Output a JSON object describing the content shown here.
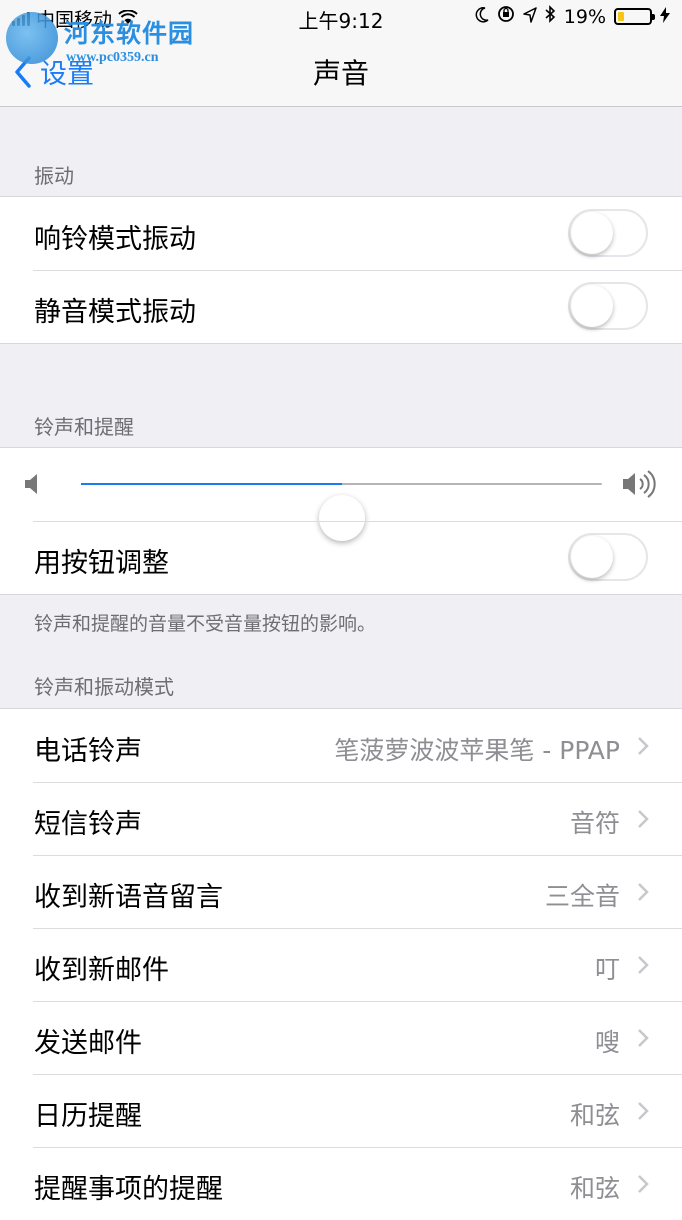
{
  "status_bar": {
    "carrier": "中国移动",
    "time": "上午9:12",
    "battery_percent": "19%",
    "battery_level": 0.19,
    "icons": [
      "signal-icon",
      "wifi-icon",
      "moon-icon",
      "rotation-lock-icon",
      "location-icon",
      "bluetooth-icon",
      "battery-icon",
      "charging-icon"
    ]
  },
  "watermark": {
    "title": "河东软件园",
    "url": "www.pc0359.cn"
  },
  "nav": {
    "back_label": "设置",
    "title": "声音"
  },
  "vibration": {
    "header": "振动",
    "items": [
      {
        "label": "响铃模式振动",
        "on": false
      },
      {
        "label": "静音模式振动",
        "on": false
      }
    ]
  },
  "ringer": {
    "header": "铃声和提醒",
    "volume_level": 0.5,
    "adjust_label": "用按钮调整",
    "adjust_on": false,
    "footer": "铃声和提醒的音量不受音量按钮的影响。"
  },
  "patterns": {
    "header": "铃声和振动模式",
    "items": [
      {
        "label": "电话铃声",
        "value": "笔菠萝波波苹果笔 - PPAP"
      },
      {
        "label": "短信铃声",
        "value": "音符"
      },
      {
        "label": "收到新语音留言",
        "value": "三全音"
      },
      {
        "label": "收到新邮件",
        "value": "叮"
      },
      {
        "label": "发送邮件",
        "value": "嗖"
      },
      {
        "label": "日历提醒",
        "value": "和弦"
      },
      {
        "label": "提醒事项的提醒",
        "value": "和弦"
      }
    ]
  },
  "colors": {
    "accent": "#1a7cf5",
    "background": "#efeff4"
  }
}
